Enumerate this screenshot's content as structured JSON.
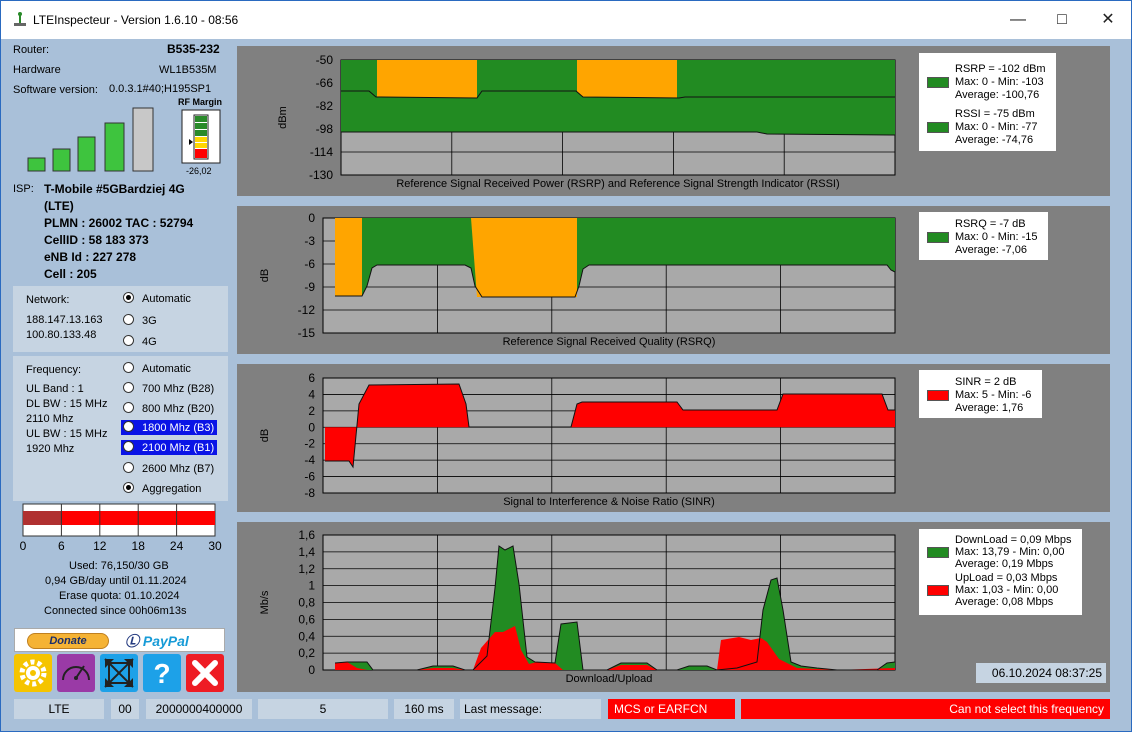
{
  "window": {
    "title": "LTEInspecteur - Version 1.6.10 - 08:56"
  },
  "router": {
    "router_label": "Router:",
    "router_value": "B535-232",
    "hardware_label": "Hardware",
    "hardware_value": "WL1B535M",
    "software_label": "Software version:",
    "software_value": "0.0.3.1#40;H195SP1",
    "rf_margin_label": "RF Margin",
    "rf_margin_value": "-26,02",
    "signal_bars": 4
  },
  "isp": {
    "label": "ISP:",
    "name_line1": "T-Mobile #5GBardziej 4G",
    "name_line2": "(LTE)",
    "plmn": "PLMN : 26002 TAC : 52794",
    "cellid": "CellID : 58 183 373",
    "enb": "eNB Id : 227 278",
    "cell": "Cell : 205"
  },
  "network": {
    "label": "Network:",
    "ip1": "188.147.13.163",
    "ip2": "100.80.133.48",
    "options": [
      "Automatic",
      "3G",
      "4G"
    ],
    "selected": 0
  },
  "frequency": {
    "label": "Frequency:",
    "ul_band": "UL Band : 1",
    "dl_bw": "DL BW : 15 MHz",
    "dl_freq": "2110 Mhz",
    "ul_bw": "UL BW : 15 MHz",
    "ul_freq": "1920 Mhz",
    "options": [
      "Automatic",
      "700 Mhz (B28)",
      "800 Mhz (B20)",
      "1800 Mhz (B3)",
      "2100 Mhz (B1)",
      "2600 Mhz (B7)",
      "Aggregation"
    ],
    "highlighted": [
      3,
      4
    ],
    "checked": 6
  },
  "quota": {
    "ticks": [
      "0",
      "6",
      "12",
      "18",
      "24",
      "30"
    ],
    "used_fraction": 0.2,
    "used": "Used: 76,150/30 GB",
    "perday": "0,94 GB/day until 01.11.2024",
    "erase": "Erase quota: 01.10.2024",
    "connected": "Connected since 00h06m13s"
  },
  "donate": {
    "donate_label": "Donate",
    "paypal_label": "PayPal"
  },
  "tools": [
    "settings-gear-icon",
    "speedometer-icon",
    "fullscreen-arrows-icon",
    "help-question-icon",
    "close-x-icon"
  ],
  "charts": {
    "rsrp": {
      "title": "Reference Signal Received Power (RSRP) and Reference Signal Strength Indicator (RSSI)",
      "ylabel": "dBm",
      "ticks": [
        "-50",
        "-66",
        "-82",
        "-98",
        "-114",
        "-130"
      ],
      "legend": {
        "line1": "RSRP = -102 dBm",
        "line2": "Max: 0 - Min: -103",
        "line3": "Average: -100,76",
        "line4": "RSSI = -75 dBm",
        "line5": "Max: 0 - Min: -77",
        "line6": "Average: -74,76"
      }
    },
    "rsrq": {
      "title": "Reference Signal Received Quality (RSRQ)",
      "ylabel": "dB",
      "ticks": [
        "0",
        "-3",
        "-6",
        "-9",
        "-12",
        "-15"
      ],
      "legend": {
        "line1": "RSRQ = -7 dB",
        "line2": "Max: 0 - Min: -15",
        "line3": "Average: -7,06"
      }
    },
    "sinr": {
      "title": "Signal to Interference & Noise Ratio (SINR)",
      "ylabel": "dB",
      "ticks": [
        "6",
        "4",
        "2",
        "0",
        "-2",
        "-4",
        "-6",
        "-8"
      ],
      "legend": {
        "line1": "SINR = 2 dB",
        "line2": "Max: 5 - Min: -6",
        "line3": "Average: 1,76"
      }
    },
    "dl": {
      "title": "Download/Upload",
      "ylabel": "Mb/s",
      "ticks": [
        "1,6",
        "1,4",
        "1,2",
        "1",
        "0,8",
        "0,6",
        "0,4",
        "0,2",
        "0"
      ],
      "legend": {
        "line1": "DownLoad = 0,09 Mbps",
        "line2": "Max: 13,79 - Min: 0,00",
        "line3": "Average: 0,19 Mbps",
        "line4": "UpLoad = 0,03 Mbps",
        "line5": "Max: 1,03 - Min: 0,00",
        "line6": "Average: 0,08 Mbps"
      },
      "timestamp": "06.10.2024 08:37:25"
    }
  },
  "statusbar": {
    "mode": "LTE",
    "code1": "00",
    "code2": "2000000400000",
    "value": "5",
    "latency": "160 ms",
    "last_message_label": "Last message:",
    "mcs": "MCS or EARFCN",
    "error": "Can not select this frequency"
  },
  "colors": {
    "green": "#228b22",
    "orange": "#ffa500",
    "red": "#ff0000",
    "plot_bg": "#a9a9a9",
    "panel_bg": "#808080"
  }
}
